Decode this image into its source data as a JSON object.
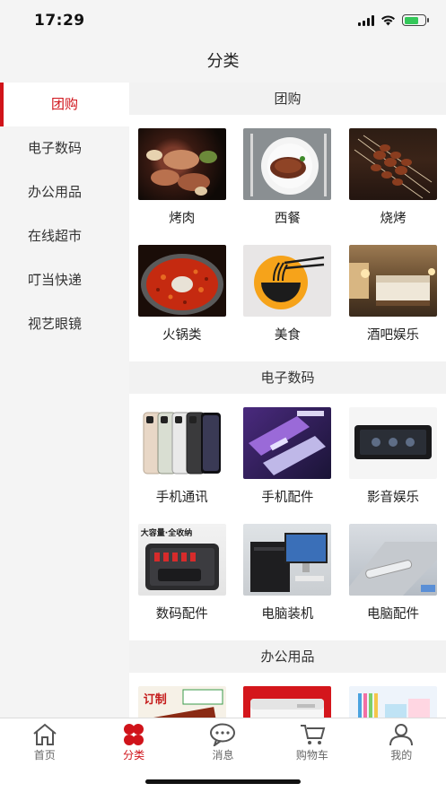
{
  "status_bar": {
    "time": "17:29"
  },
  "header": {
    "title": "分类"
  },
  "sidebar": {
    "items": [
      {
        "label": "团购",
        "active": true
      },
      {
        "label": "电子数码",
        "active": false
      },
      {
        "label": "办公用品",
        "active": false
      },
      {
        "label": "在线超市",
        "active": false
      },
      {
        "label": "叮当快递",
        "active": false
      },
      {
        "label": "视艺眼镜",
        "active": false
      }
    ]
  },
  "sections": [
    {
      "title": "团购",
      "items": [
        {
          "label": "烤肉",
          "icon": "grilled-meat-image"
        },
        {
          "label": "西餐",
          "icon": "steak-plate-image"
        },
        {
          "label": "烧烤",
          "icon": "skewers-image"
        },
        {
          "label": "火锅类",
          "icon": "hotpot-image"
        },
        {
          "label": "美食",
          "icon": "noodle-bowl-image"
        },
        {
          "label": "酒吧娱乐",
          "icon": "hotel-room-image"
        }
      ]
    },
    {
      "title": "电子数码",
      "items": [
        {
          "label": "手机通讯",
          "icon": "smartphones-image"
        },
        {
          "label": "手机配件",
          "icon": "phone-accessory-image"
        },
        {
          "label": "影音娱乐",
          "icon": "media-device-image"
        },
        {
          "label": "数码配件",
          "icon": "storage-case-image",
          "image_caption": "大容量·全收纳"
        },
        {
          "label": "电脑装机",
          "icon": "desktop-pc-image"
        },
        {
          "label": "电脑配件",
          "icon": "usb-hub-image"
        }
      ]
    },
    {
      "title": "办公用品",
      "items": [
        {
          "label": "",
          "icon": "notebook-image",
          "image_caption": "订制"
        },
        {
          "label": "",
          "icon": "printer-image"
        },
        {
          "label": "",
          "icon": "stationery-image"
        }
      ]
    }
  ],
  "tab_bar": {
    "tabs": [
      {
        "label": "首页",
        "icon": "home-icon",
        "active": false
      },
      {
        "label": "分类",
        "icon": "category-icon",
        "active": true
      },
      {
        "label": "消息",
        "icon": "message-icon",
        "active": false
      },
      {
        "label": "购物车",
        "icon": "cart-icon",
        "active": false
      },
      {
        "label": "我的",
        "icon": "profile-icon",
        "active": false
      }
    ]
  },
  "colors": {
    "accent": "#d0131a",
    "sidebar_bg": "#f4f4f4",
    "section_header_bg": "#f2f2f2"
  }
}
